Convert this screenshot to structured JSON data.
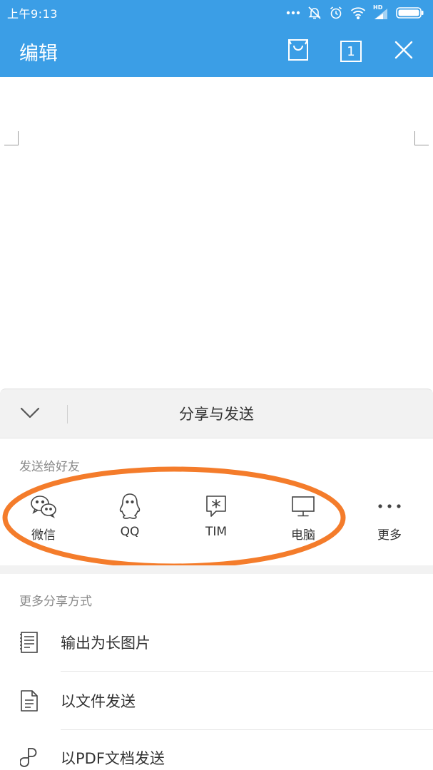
{
  "status_bar": {
    "time": "上午9:13",
    "network_badge": "HD"
  },
  "app_bar": {
    "title": "编辑",
    "tab_count": "1"
  },
  "share_sheet": {
    "title": "分享与发送",
    "friends_section": {
      "label": "发送给好友",
      "targets": [
        {
          "label": "微信",
          "icon": "wechat-icon"
        },
        {
          "label": "QQ",
          "icon": "qq-icon"
        },
        {
          "label": "TIM",
          "icon": "tim-icon"
        },
        {
          "label": "电脑",
          "icon": "computer-icon"
        },
        {
          "label": "更多",
          "icon": "more-dots-icon"
        }
      ]
    },
    "more_section": {
      "label": "更多分享方式",
      "options": [
        {
          "label": "输出为长图片",
          "icon": "long-image-icon"
        },
        {
          "label": "以文件发送",
          "icon": "file-icon"
        },
        {
          "label": "以PDF文档发送",
          "icon": "pdf-icon"
        }
      ]
    }
  },
  "colors": {
    "primary": "#3b9ee6",
    "highlight": "#f47c2b",
    "text": "#333333",
    "secondary_text": "#8a8a8a"
  }
}
